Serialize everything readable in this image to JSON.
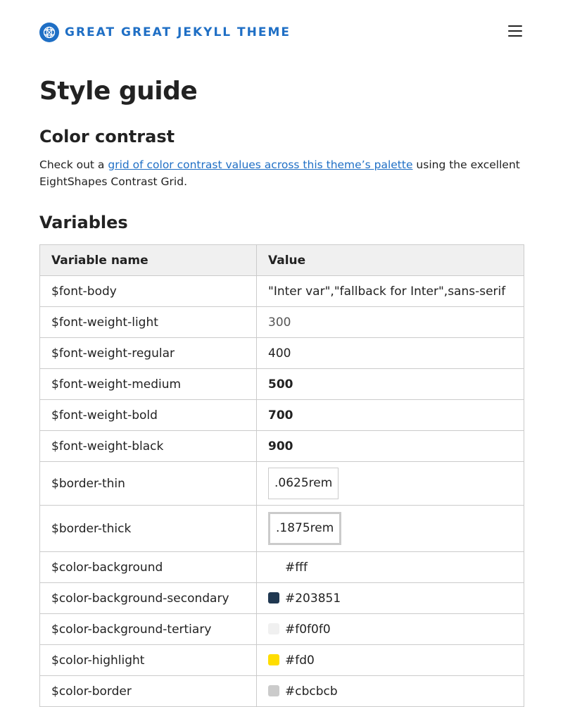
{
  "header": {
    "brand_name": "GREAT GREAT JEKYLL THEME",
    "brand_color": "#1f6fc5",
    "logo_icon": "globe-icon",
    "menu_icon": "hamburger-menu-icon"
  },
  "page": {
    "title": "Style guide",
    "sections": {
      "contrast": {
        "heading": "Color contrast",
        "text_before": "Check out a ",
        "link_text": "grid of color contrast values across this theme’s palette",
        "text_after": " using the excellent EightShapes Contrast Grid."
      },
      "variables": {
        "heading": "Variables"
      }
    }
  },
  "table": {
    "headers": [
      "Variable name",
      "Value"
    ],
    "rows": [
      {
        "name": "$font-body",
        "value": "\"Inter var\",\"fallback for Inter\",sans-serif"
      },
      {
        "name": "$font-weight-light",
        "value": "300"
      },
      {
        "name": "$font-weight-regular",
        "value": "400"
      },
      {
        "name": "$font-weight-medium",
        "value": "500"
      },
      {
        "name": "$font-weight-bold",
        "value": "700"
      },
      {
        "name": "$font-weight-black",
        "value": "900"
      },
      {
        "name": "$border-thin",
        "value": ".0625rem"
      },
      {
        "name": "$border-thick",
        "value": ".1875rem"
      },
      {
        "name": "$color-background",
        "value": "#fff",
        "swatch": "#ffffff"
      },
      {
        "name": "$color-background-secondary",
        "value": "#203851",
        "swatch": "#203851"
      },
      {
        "name": "$color-background-tertiary",
        "value": "#f0f0f0",
        "swatch": "#f0f0f0"
      },
      {
        "name": "$color-highlight",
        "value": "#fd0",
        "swatch": "#ffdd00"
      },
      {
        "name": "$color-border",
        "value": "#cbcbcb",
        "swatch": "#cbcbcb"
      }
    ]
  }
}
